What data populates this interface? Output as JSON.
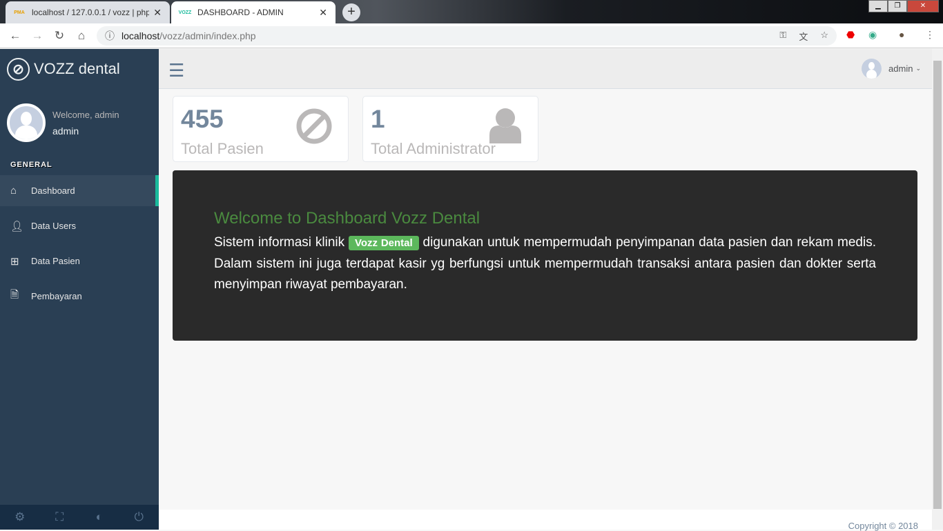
{
  "browser": {
    "tabs": [
      {
        "label": "localhost / 127.0.0.1 / vozz | phpMyAdmin",
        "favicon": "PMA"
      },
      {
        "label": "DASHBOARD - ADMIN",
        "favicon": "VOZZ"
      }
    ],
    "url_host": "localhost",
    "url_path": "/vozz/admin/index.php"
  },
  "sidebar": {
    "brand": "VOZZ dental",
    "welcome": "Welcome, admin",
    "username": "admin",
    "section": "GENERAL",
    "items": [
      {
        "label": "Dashboard",
        "icon": "home-icon"
      },
      {
        "label": "Data Users",
        "icon": "user-icon"
      },
      {
        "label": "Data Pasien",
        "icon": "medkit-icon"
      },
      {
        "label": "Pembayaran",
        "icon": "file-icon"
      }
    ]
  },
  "topnav": {
    "user": "admin"
  },
  "stats": [
    {
      "value": "455",
      "label": "Total Pasien"
    },
    {
      "value": "1",
      "label": "Total Administrator"
    }
  ],
  "welcome": {
    "title": "Welcome to Dashboard Vozz Dental",
    "text_before": "Sistem informasi klinik ",
    "badge": "Vozz Dental",
    "text_after": " digunakan untuk mempermudah penyimpanan data pasien dan rekam medis. Dalam sistem ini juga terdapat kasir yg berfungsi untuk mempermudah transaksi antara pasien dan dokter serta menyimpan riwayat pembayaran."
  },
  "footer": {
    "copyright": "Copyright © 2018"
  },
  "colors": {
    "sidebar": "#2a3f54",
    "accent": "#1abb9c",
    "badge": "#5cb85c"
  }
}
